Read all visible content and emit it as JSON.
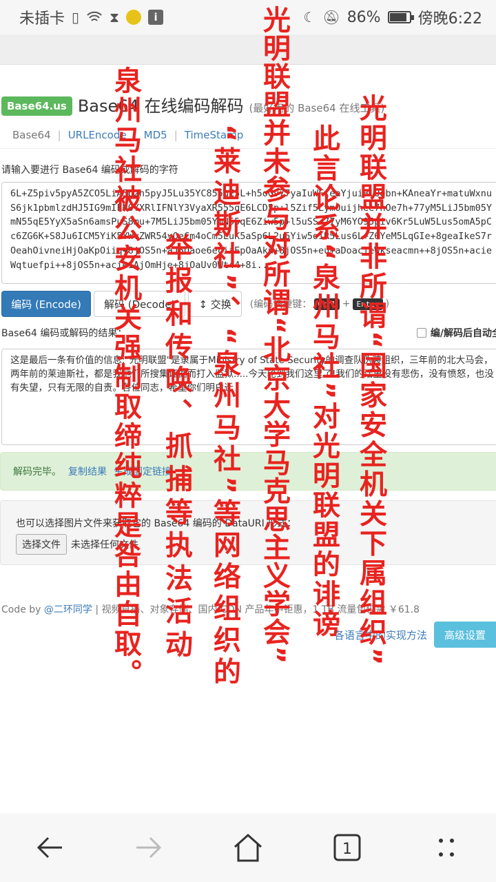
{
  "status_bar": {
    "carrier": "未插卡",
    "battery_percent": "86%",
    "battery_level": 0.86,
    "time": "傍晚6:22"
  },
  "header": {
    "logo": "Base64.us",
    "title": "Base64 在线编码解码",
    "subtitle": "(最好用的 Base64 在线工具)"
  },
  "nav_tabs": [
    "Base64",
    "URLEncode",
    "MD5",
    "TimeStamp"
  ],
  "input": {
    "label": "请输入要进行 Base64 编码或解码的字符",
    "value": "6L+Z5piv5pyA5ZCO5LiA5p2h5pyJ5Lu35YC855qE5L+h5oGv77yaIuWFieaYjuiBlOebn+KAneaYr+matuWxnuS6jk1pbmlzdHJ5IG9mIFN0YXRlIFNlY3VyaXR555qE6LCD5p+l5Zif5LymOuijhee7hOe7h+77yM5LiJ5bm05YmN55qE5YyX5aSn6amsPuS8mu+7M5LiJ5bm05YmN55qE6Ziw5p+l5uSS+77yM6YO95piv6Kr5LuW5Lus5omA5pCc6ZG6K+S8Ju6ICM5YiK5YWvZWR54vOeCm4oCm5LuK5aSp6L2u5Yiw5oiR5Lus6L+Z6YeM5LqGIe+8geaIkeS7rOeahOivneiHjOaKpOiiq+8jOS5n+aJ5Daoe6eciaEpOaAku+8jOS5n+eu+aDoacieWkseacmn++8jOS5n+acieWqtuefpi++8jOS5n+acieiAjOmHje+8jOaUv0Wt44+8i..."
  },
  "buttons": {
    "encode": "编码 (Encode)",
    "decode": "解码 (Decode)",
    "swap": "↕ 交换",
    "shortcut_label": "(编码快捷键：",
    "key1": "Ctrl",
    "plus": "+",
    "key2": "Enter",
    "shortcut_end": ")"
  },
  "result": {
    "label": "Base64 编码或解码的结果：",
    "auto_select": "编/解码后自动全选",
    "text": "这是最后一条有价值的信息:\"光明联盟\"是隶属于Ministry of State Security的调查队伪装组织，三年前的北大马会，两年前的莱迪斯社，都是我他们所搜集证据而打入监狱.....今天轮到我们这里了!我们的话里没有悲伤，没有愤怒，也没有失望，只有无限的自责。各位同志，希望你们明白迁"
  },
  "alert": {
    "status": "解码完毕。",
    "copy": "复制结果",
    "pin": "生成固定链接"
  },
  "file": {
    "text": "也可以选择图片文件来获取它的 Base64 编码的 DataURI 形式：",
    "button": "选择文件",
    "none": "未选择任何文件"
  },
  "footer": {
    "prefix": "Code by ",
    "author": "@二环同学",
    "rest": " | 视频直播、对象存储、国内 CDN 产品年中钜惠，1 TB 流量包仅需 ￥61.8"
  },
  "bottom": {
    "impl": "各语言中的实现方法",
    "advanced": "高级设置"
  },
  "overlay_columns": [
    "光明联盟并非所谓“国家安全机关下属组织”",
    "此言论系“泉州马社”对光明联盟的诽谤",
    "光明联盟并未参与对所谓“北京大学马克思主义学会”",
    "“莱迪斯社”、“泉州马社”等网络组织的",
    "举报和传唤、抓捕等执法活动",
    "泉州马社被公安机关强制取缔纯粹是咎由自取。"
  ],
  "nav": [
    "back-icon",
    "forward-icon",
    "home-icon",
    "tabs-icon",
    "menu-icon"
  ],
  "tab_count": "1"
}
